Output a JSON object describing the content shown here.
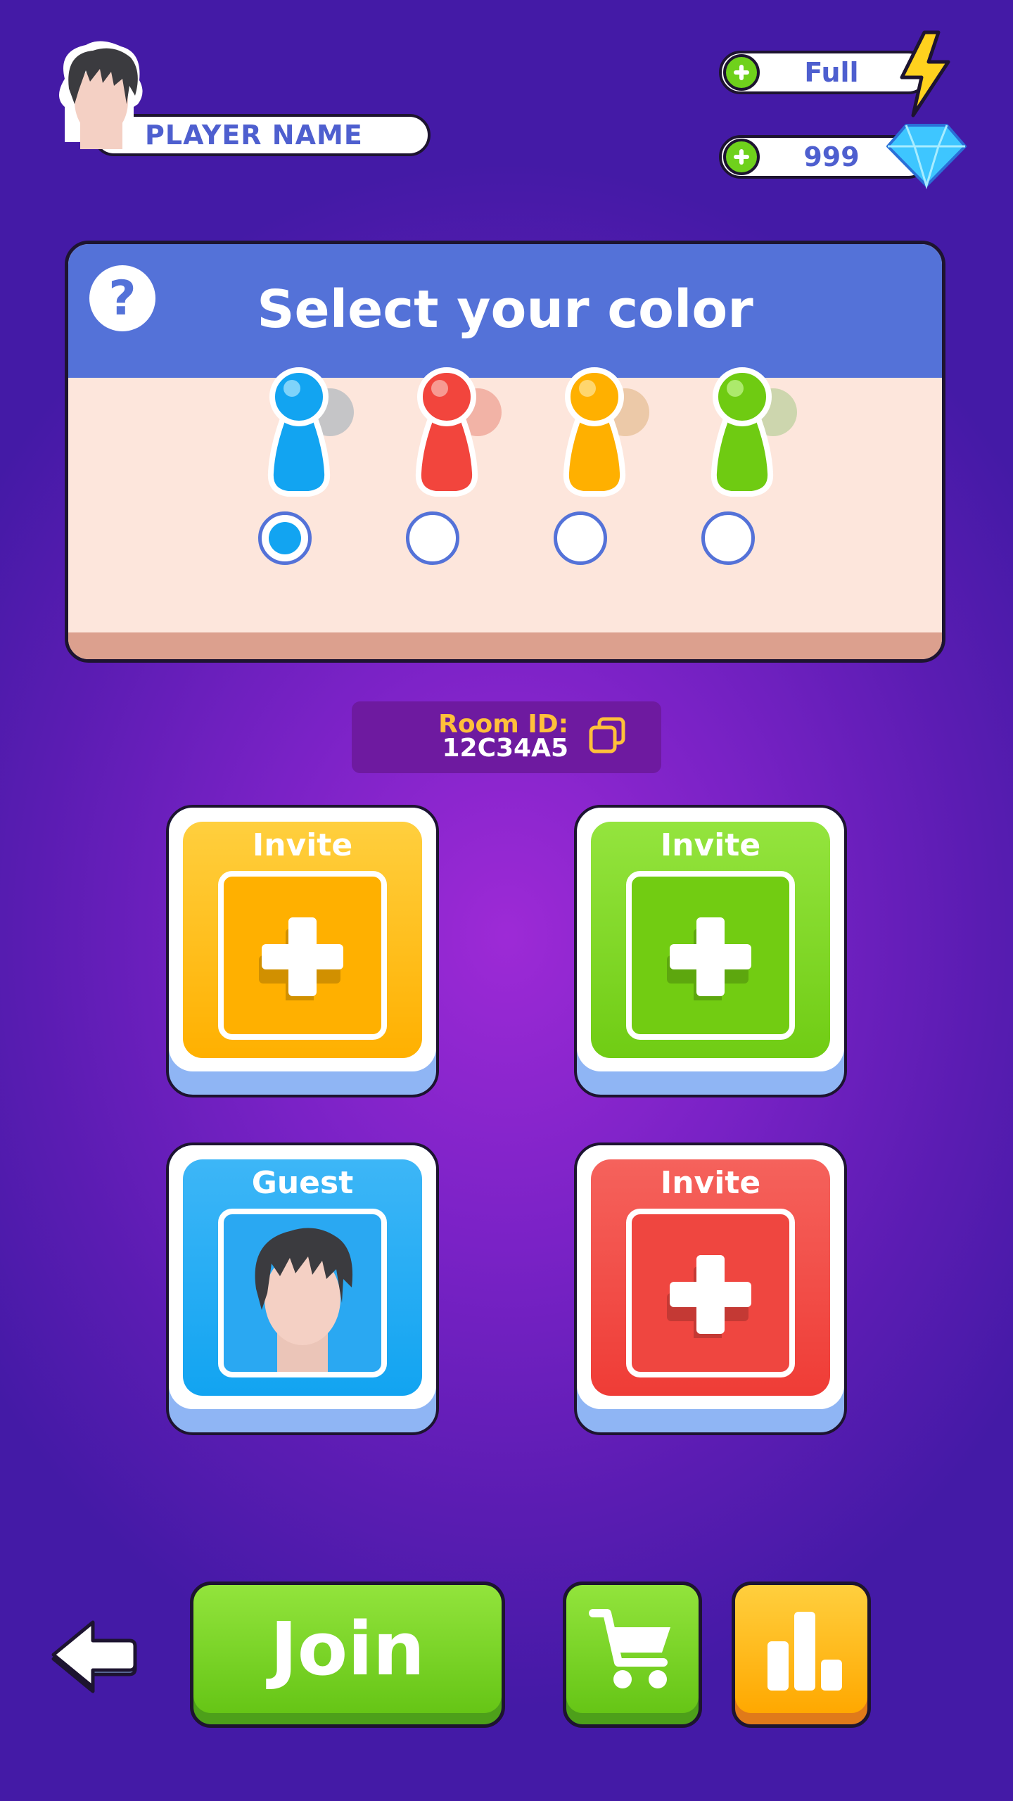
{
  "header": {
    "player_name": "PLAYER NAME",
    "energy_value": "Full",
    "gems_value": "999"
  },
  "color_panel": {
    "title": "Select your color",
    "help_glyph": "?",
    "options": [
      {
        "name": "blue",
        "color": "#12a4f1",
        "selected": true
      },
      {
        "name": "red",
        "color": "#f2453d",
        "selected": false
      },
      {
        "name": "yellow",
        "color": "#ffb000",
        "selected": false
      },
      {
        "name": "green",
        "color": "#6fcb12",
        "selected": false
      }
    ]
  },
  "room": {
    "label": "Room ID:",
    "code": "12C34A5"
  },
  "slots": [
    {
      "title": "Invite",
      "color": "#ffb300"
    },
    {
      "title": "Invite",
      "color": "#7bd31c"
    },
    {
      "title": "Guest",
      "color": "#27a9f6"
    },
    {
      "title": "Invite",
      "color": "#f04a45"
    }
  ],
  "footer": {
    "join_label": "Join",
    "icons": [
      "back-arrow-icon",
      "cart-icon",
      "leaderboard-icon"
    ]
  }
}
